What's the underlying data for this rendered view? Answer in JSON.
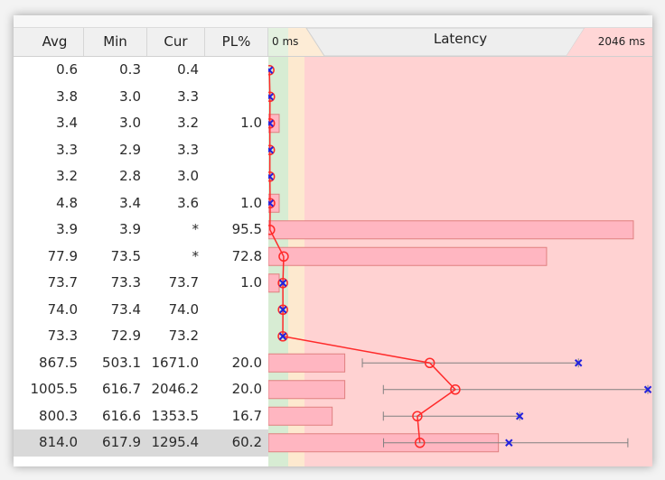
{
  "columns": [
    "Avg",
    "Min",
    "Cur",
    "PL%"
  ],
  "latency": {
    "title": "Latency",
    "min_label": "0 ms",
    "max_label": "2046 ms",
    "max_ms": 2046
  },
  "rows": [
    {
      "avg": "0.6",
      "min": "0.3",
      "cur": "0.4",
      "pl": "",
      "avg_ms": 0.6,
      "min_ms": 0.3,
      "cur_ms": 0.4,
      "max_ms": 0.6,
      "pl_pct": 0
    },
    {
      "avg": "3.8",
      "min": "3.0",
      "cur": "3.3",
      "pl": "",
      "avg_ms": 3.8,
      "min_ms": 3.0,
      "cur_ms": 3.3,
      "max_ms": 3.8,
      "pl_pct": 0
    },
    {
      "avg": "3.4",
      "min": "3.0",
      "cur": "3.2",
      "pl": "1.0",
      "avg_ms": 3.4,
      "min_ms": 3.0,
      "cur_ms": 3.2,
      "max_ms": 3.4,
      "pl_pct": 1.0
    },
    {
      "avg": "3.3",
      "min": "2.9",
      "cur": "3.3",
      "pl": "",
      "avg_ms": 3.3,
      "min_ms": 2.9,
      "cur_ms": 3.3,
      "max_ms": 3.3,
      "pl_pct": 0
    },
    {
      "avg": "3.2",
      "min": "2.8",
      "cur": "3.0",
      "pl": "",
      "avg_ms": 3.2,
      "min_ms": 2.8,
      "cur_ms": 3.0,
      "max_ms": 3.2,
      "pl_pct": 0
    },
    {
      "avg": "4.8",
      "min": "3.4",
      "cur": "3.6",
      "pl": "1.0",
      "avg_ms": 4.8,
      "min_ms": 3.4,
      "cur_ms": 3.6,
      "max_ms": 4.8,
      "pl_pct": 1.0
    },
    {
      "avg": "3.9",
      "min": "3.9",
      "cur": "*",
      "pl": "95.5",
      "avg_ms": 3.9,
      "min_ms": 3.9,
      "cur_ms": null,
      "max_ms": 3.9,
      "pl_pct": 95.5
    },
    {
      "avg": "77.9",
      "min": "73.5",
      "cur": "*",
      "pl": "72.8",
      "avg_ms": 77.9,
      "min_ms": 73.5,
      "cur_ms": null,
      "max_ms": 77.9,
      "pl_pct": 72.8
    },
    {
      "avg": "73.7",
      "min": "73.3",
      "cur": "73.7",
      "pl": "1.0",
      "avg_ms": 73.7,
      "min_ms": 73.3,
      "cur_ms": 73.7,
      "max_ms": 73.7,
      "pl_pct": 1.0
    },
    {
      "avg": "74.0",
      "min": "73.4",
      "cur": "74.0",
      "pl": "",
      "avg_ms": 74.0,
      "min_ms": 73.4,
      "cur_ms": 74.0,
      "max_ms": 74.0,
      "pl_pct": 0
    },
    {
      "avg": "73.3",
      "min": "72.9",
      "cur": "73.2",
      "pl": "",
      "avg_ms": 73.3,
      "min_ms": 72.9,
      "cur_ms": 73.2,
      "max_ms": 73.3,
      "pl_pct": 0
    },
    {
      "avg": "867.5",
      "min": "503.1",
      "cur": "1671.0",
      "pl": "20.0",
      "avg_ms": 867.5,
      "min_ms": 503.1,
      "cur_ms": 1671.0,
      "max_ms": 1671.0,
      "pl_pct": 20.0
    },
    {
      "avg": "1005.5",
      "min": "616.7",
      "cur": "2046.2",
      "pl": "20.0",
      "avg_ms": 1005.5,
      "min_ms": 616.7,
      "cur_ms": 2046.2,
      "max_ms": 2046.2,
      "pl_pct": 20.0
    },
    {
      "avg": "800.3",
      "min": "616.6",
      "cur": "1353.5",
      "pl": "16.7",
      "avg_ms": 800.3,
      "min_ms": 616.6,
      "cur_ms": 1353.5,
      "max_ms": 1353.5,
      "pl_pct": 16.7
    },
    {
      "avg": "814.0",
      "min": "617.9",
      "cur": "1295.4",
      "pl": "60.2",
      "avg_ms": 814.0,
      "min_ms": 617.9,
      "cur_ms": 1295.4,
      "max_ms": 1938.0,
      "pl_pct": 60.2,
      "selected": true
    }
  ],
  "colors": {
    "zone_green": "#d7ecd3",
    "zone_yellow": "#fde9cf",
    "zone_red": "#ffd2d2",
    "pl_bar": "#ffb6c1",
    "pl_bar_border": "#e08080",
    "avg_line": "#ff2a2a",
    "cur_marker": "#2222dd",
    "range_line": "#808080"
  }
}
